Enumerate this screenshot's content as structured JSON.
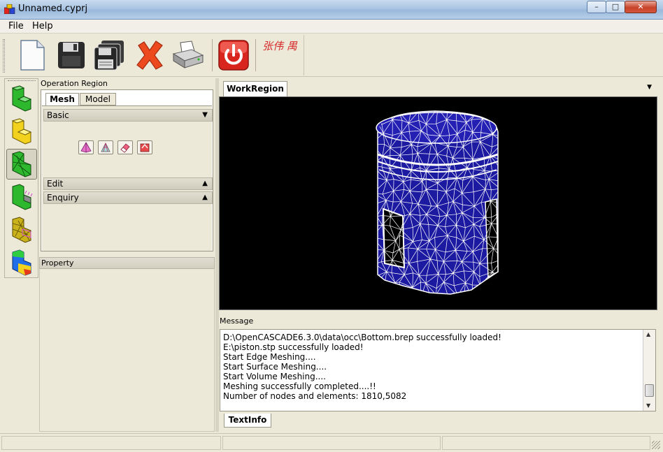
{
  "window": {
    "title": "Unnamed.cyprj",
    "controls": {
      "minimize": "–",
      "maximize": "□",
      "close": "✕"
    }
  },
  "menu": {
    "items": [
      "File",
      "Help"
    ]
  },
  "toolbar": {
    "buttons": [
      "new-file",
      "save",
      "save-all",
      "delete",
      "print",
      "exit"
    ],
    "signature": "张伟 禺",
    "colors": {
      "exit": "#d8261f",
      "delete": "#e8461f"
    }
  },
  "side_tools": [
    "green-block",
    "yellow-block",
    "wireframe-block",
    "mesh-block",
    "surface-mesh-block",
    "colored-result-block"
  ],
  "operation_region": {
    "title": "Operation Region",
    "tabs": [
      "Mesh",
      "Model"
    ],
    "groups": {
      "basic": {
        "label": "Basic",
        "arrow": "▼"
      },
      "edit": {
        "label": "Edit",
        "arrow": "▲"
      },
      "enquiry": {
        "label": "Enquiry",
        "arrow": "▲"
      }
    },
    "mesh_tools": [
      "tetra-mesh-icon",
      "surface-mesh-icon",
      "eraser-icon",
      "refine-icon"
    ]
  },
  "property": {
    "title": "Property"
  },
  "work_region": {
    "tab": "WorkRegion",
    "dropdown": "▼",
    "viewport": {
      "background": "#000000",
      "model_fill": "#1c1aa0",
      "wire": "#ffffff"
    }
  },
  "message": {
    "title": "Message",
    "lines": [
      "D:\\OpenCASCADE6.3.0\\data\\occ\\Bottom.brep successfully loaded!",
      "E:\\piston.stp successfully loaded!",
      "Start Edge Meshing....",
      "Start Surface Meshing....",
      "Start Volume Meshing....",
      "Meshing successfully completed....!!",
      "Number of nodes and elements: 1810,5082"
    ],
    "tab": "TextInfo"
  }
}
